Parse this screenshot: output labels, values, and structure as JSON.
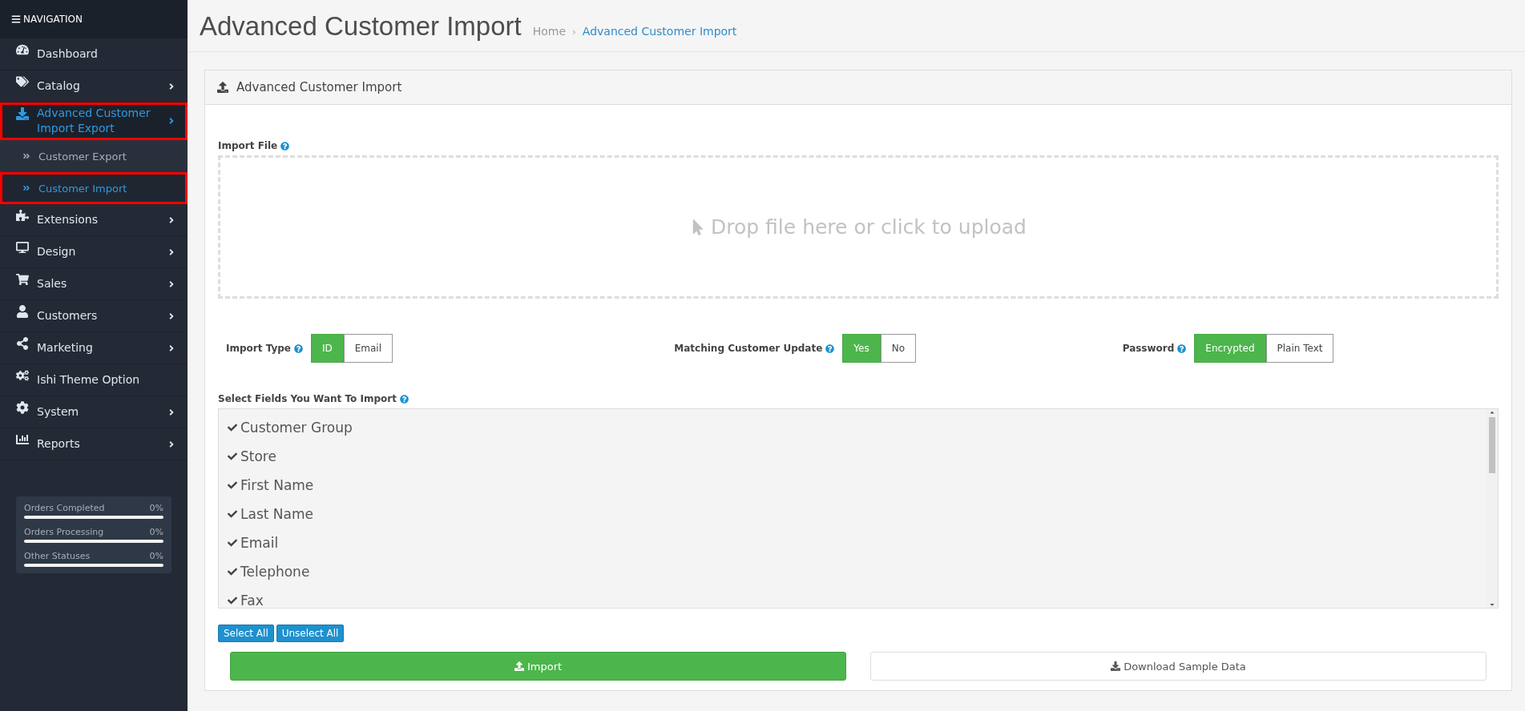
{
  "sidebar": {
    "title": "NAVIGATION",
    "items": [
      {
        "label": "Dashboard",
        "has_submenu": false,
        "highlighted": false,
        "selected": false
      },
      {
        "label": "Catalog",
        "has_submenu": true,
        "highlighted": false,
        "selected": false
      },
      {
        "label": "Advanced Customer Import Export",
        "has_submenu": true,
        "highlighted": true,
        "selected": true,
        "children": [
          {
            "label": "Customer Export",
            "highlighted": false,
            "selected": false
          },
          {
            "label": "Customer Import",
            "highlighted": true,
            "selected": true
          }
        ]
      },
      {
        "label": "Extensions",
        "has_submenu": true,
        "highlighted": false,
        "selected": false
      },
      {
        "label": "Design",
        "has_submenu": true,
        "highlighted": false,
        "selected": false
      },
      {
        "label": "Sales",
        "has_submenu": true,
        "highlighted": false,
        "selected": false
      },
      {
        "label": "Customers",
        "has_submenu": true,
        "highlighted": false,
        "selected": false
      },
      {
        "label": "Marketing",
        "has_submenu": true,
        "highlighted": false,
        "selected": false
      },
      {
        "label": "Ishi Theme Option",
        "has_submenu": false,
        "highlighted": false,
        "selected": false
      },
      {
        "label": "System",
        "has_submenu": true,
        "highlighted": false,
        "selected": false
      },
      {
        "label": "Reports",
        "has_submenu": true,
        "highlighted": false,
        "selected": false
      }
    ],
    "stats": [
      {
        "label": "Orders Completed",
        "reading": "0%",
        "level": 0
      },
      {
        "label": "Orders Processing",
        "reading": "0%",
        "level": 0
      },
      {
        "label": "Other Statuses",
        "reading": "0%",
        "level": 0
      }
    ]
  },
  "page": {
    "title": "Advanced Customer Import",
    "separator": "›",
    "breadcrumb": [
      {
        "label": "Home",
        "selected": false
      },
      {
        "label": "Advanced Customer Import",
        "selected": true
      }
    ]
  },
  "panel": {
    "title": "Advanced Customer Import",
    "import_file": {
      "label": "Import File",
      "dropzone": "Drop file here or click to upload"
    },
    "toggles": [
      {
        "label": "Import Type",
        "options": [
          {
            "label": "ID",
            "selected": true
          },
          {
            "label": "Email",
            "selected": false
          }
        ]
      },
      {
        "label": "Matching Customer Update",
        "options": [
          {
            "label": "Yes",
            "selected": true
          },
          {
            "label": "No",
            "selected": false
          }
        ]
      },
      {
        "label": "Password",
        "options": [
          {
            "label": "Encrypted",
            "selected": true
          },
          {
            "label": "Plain Text",
            "selected": false
          }
        ]
      }
    ],
    "fields": {
      "label": "Select Fields You Want To Import",
      "items": [
        {
          "label": "Customer Group",
          "checked": true
        },
        {
          "label": "Store",
          "checked": true
        },
        {
          "label": "First Name",
          "checked": true
        },
        {
          "label": "Last Name",
          "checked": true
        },
        {
          "label": "Email",
          "checked": true
        },
        {
          "label": "Telephone",
          "checked": true
        },
        {
          "label": "Fax",
          "checked": true
        }
      ]
    },
    "select_buttons": [
      "Select All",
      "Unselect All"
    ],
    "import_button": "Import",
    "download_button": "Download Sample Data"
  }
}
